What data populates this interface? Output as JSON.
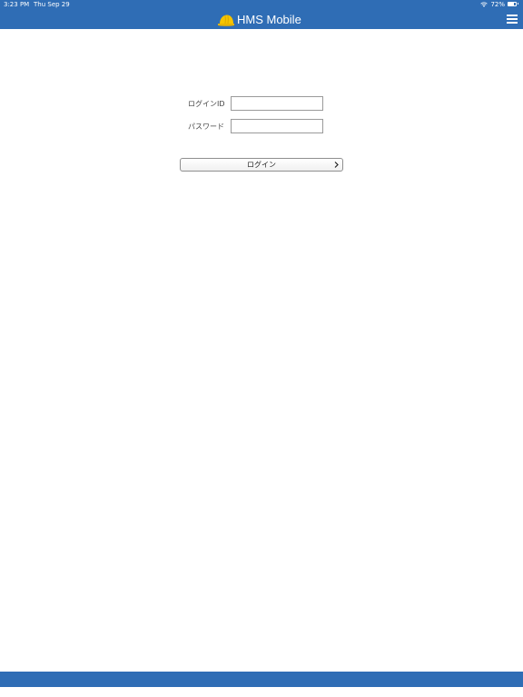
{
  "status_bar": {
    "time": "3:23 PM",
    "date": "Thu Sep 29",
    "battery_percent": "72%",
    "battery_level": 0.72,
    "wifi_icon": "wifi-icon",
    "battery_icon": "battery-icon"
  },
  "header": {
    "title": "HMS Mobile",
    "logo_icon": "helmet-icon",
    "menu_icon": "hamburger-menu-icon"
  },
  "login_form": {
    "login_id_label": "ログインID",
    "login_id_value": "",
    "password_label": "パスワード",
    "password_value": "",
    "login_button_label": "ログイン",
    "login_button_icon": "chevron-right-icon"
  },
  "colors": {
    "brand_blue": "#2f6db5",
    "helmet_yellow": "#f5c400",
    "background": "#ffffff"
  }
}
